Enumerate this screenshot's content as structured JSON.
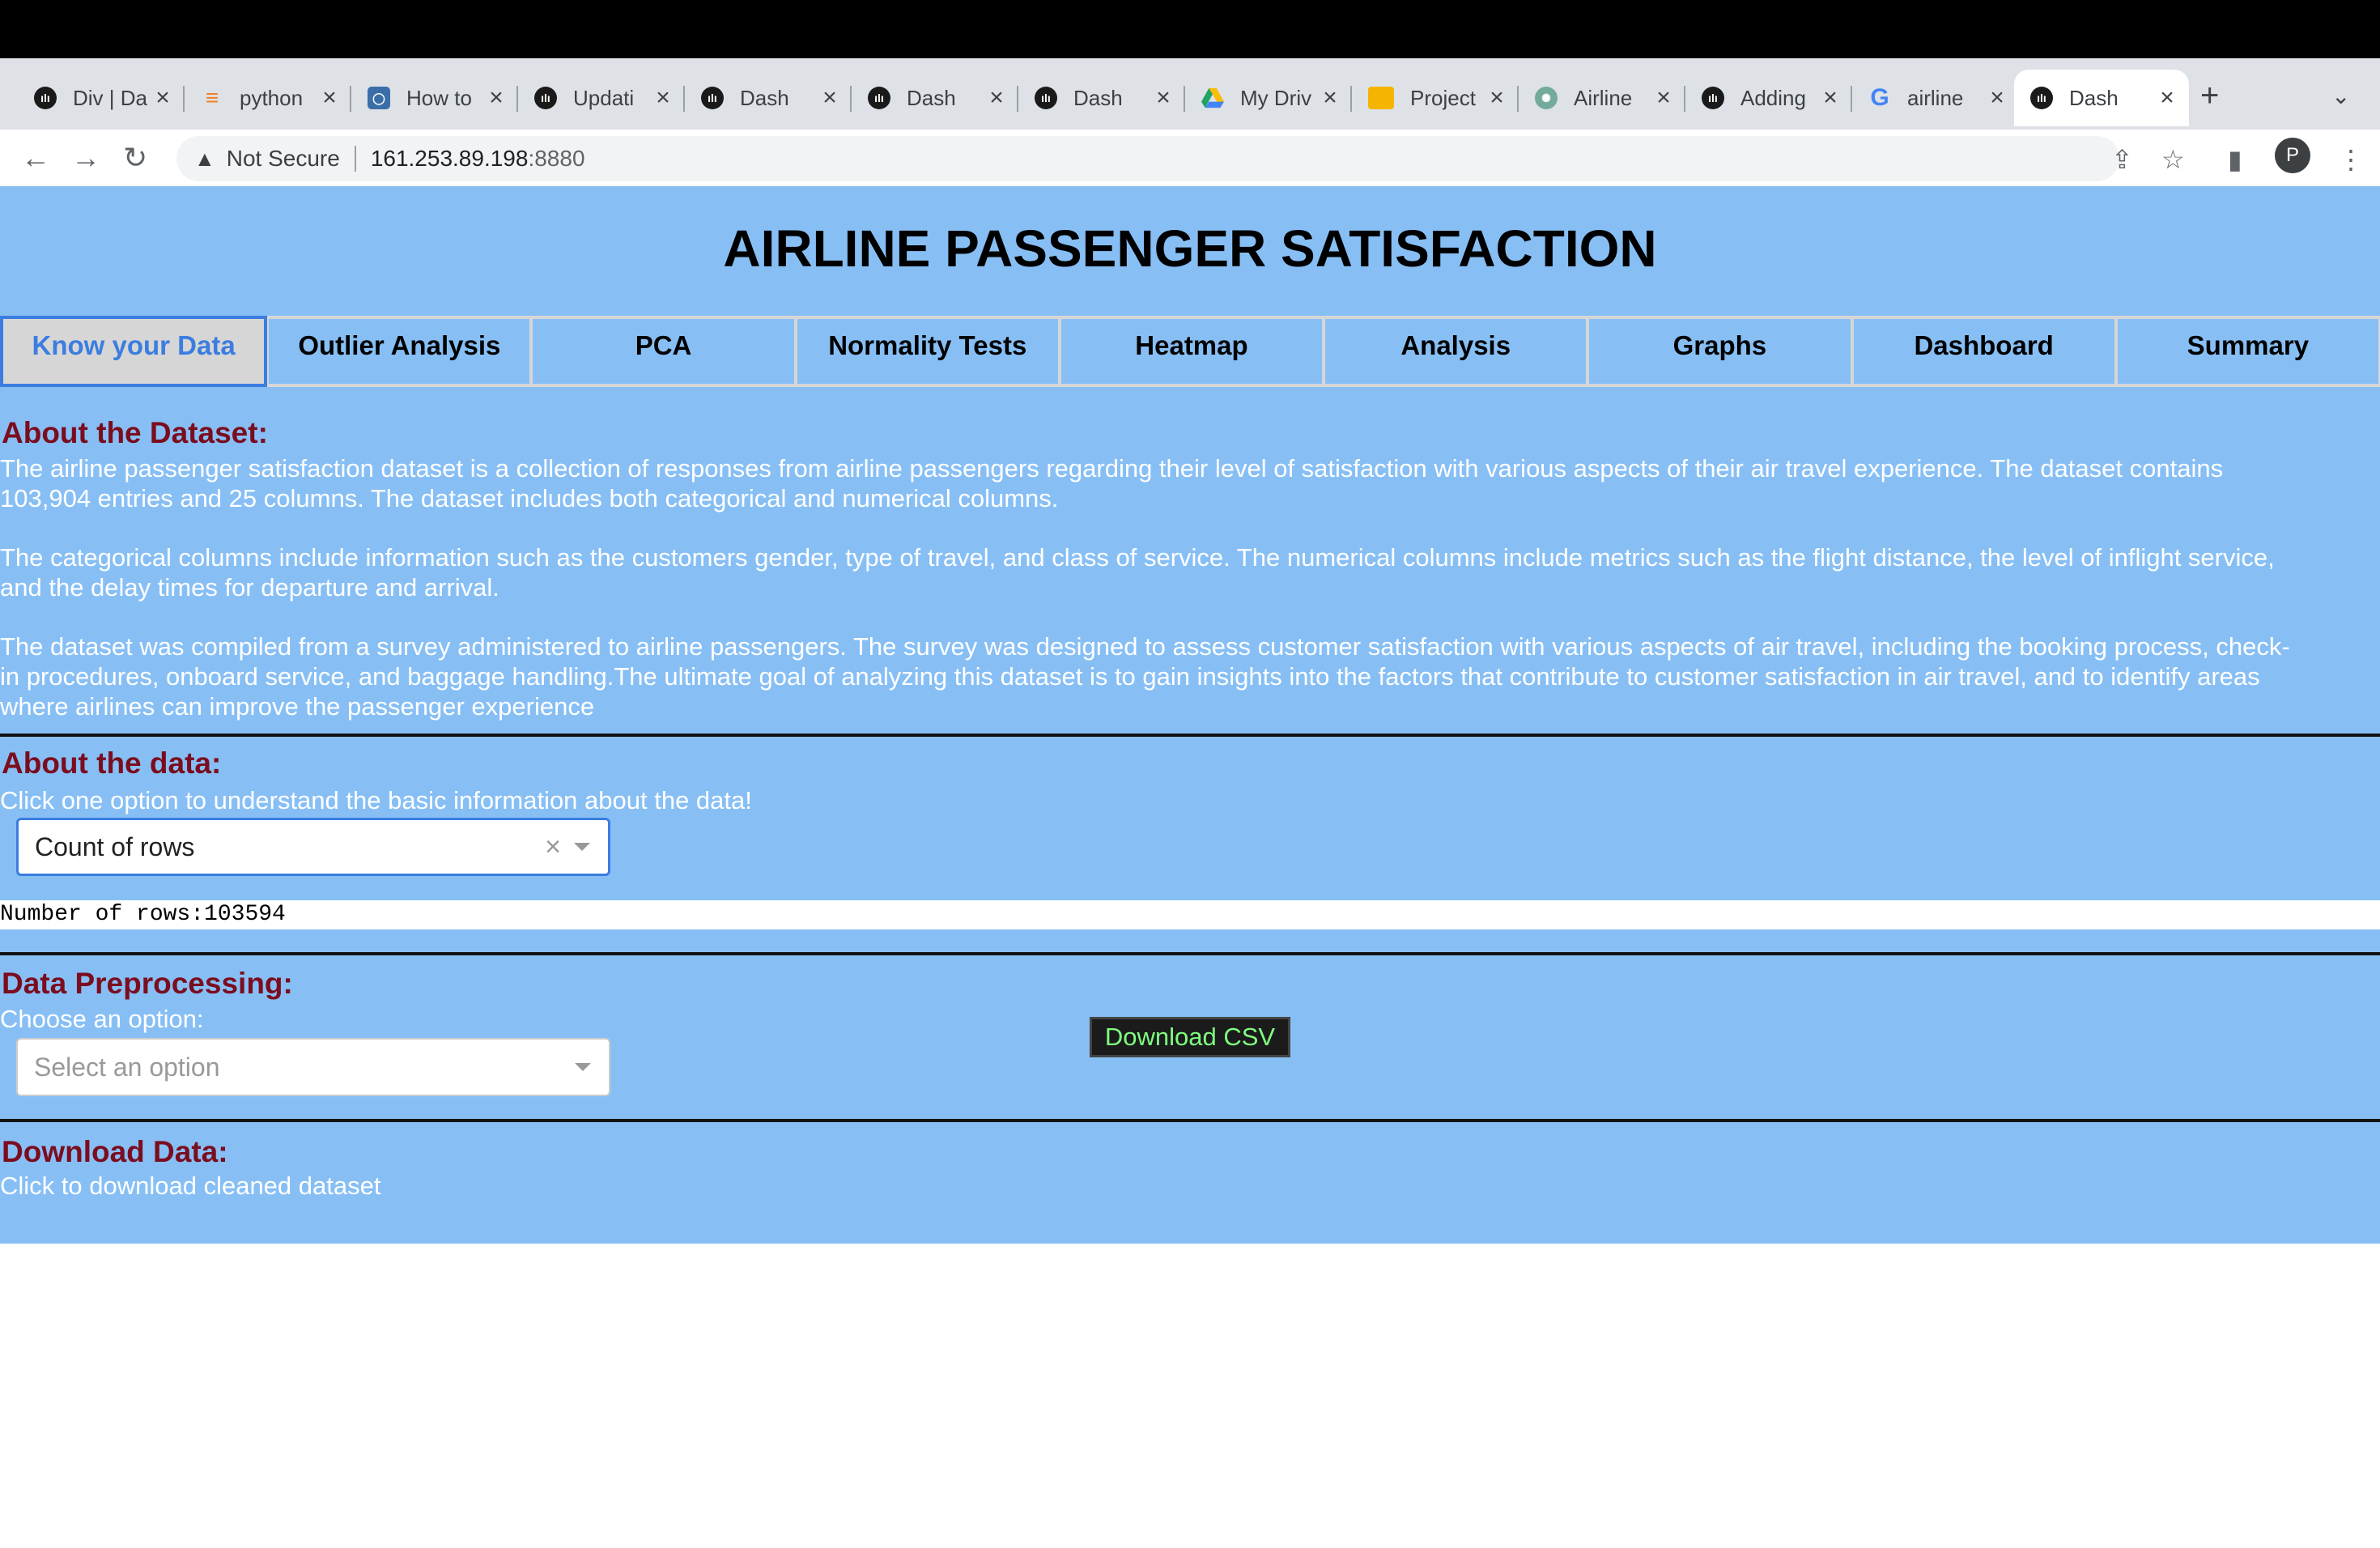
{
  "browser": {
    "tabs": [
      {
        "title": "Div | Da",
        "icon": "dash-icon"
      },
      {
        "title": "python",
        "icon": "stackoverflow-icon"
      },
      {
        "title": "How to",
        "icon": "blog-icon"
      },
      {
        "title": "Updati",
        "icon": "dash-icon"
      },
      {
        "title": "Dash",
        "icon": "dash-icon"
      },
      {
        "title": "Dash",
        "icon": "dash-icon"
      },
      {
        "title": "Dash",
        "icon": "dash-icon"
      },
      {
        "title": "My Driv",
        "icon": "google-drive-icon"
      },
      {
        "title": "Project",
        "icon": "google-slides-icon"
      },
      {
        "title": "Airline",
        "icon": "chatgpt-icon"
      },
      {
        "title": "Adding",
        "icon": "dash-icon"
      },
      {
        "title": "airline",
        "icon": "google-icon"
      },
      {
        "title": "Dash",
        "icon": "dash-icon",
        "active": true
      }
    ],
    "address": {
      "security_label": "Not Secure",
      "host": "161.253.89.198",
      "port": ":8880"
    },
    "profile_initial": "P"
  },
  "app": {
    "title": "AIRLINE PASSENGER SATISFACTION",
    "tabs": [
      "Know your Data",
      "Outlier Analysis",
      "PCA",
      "Normality Tests",
      "Heatmap",
      "Analysis",
      "Graphs",
      "Dashboard",
      "Summary"
    ],
    "selected_tab": "Know your Data"
  },
  "about_dataset": {
    "heading": "About the Dataset:",
    "p1_line1": "The airline passenger satisfaction dataset is a collection of responses from airline passengers regarding their level of satisfaction with various aspects of their air travel experience. The dataset contains",
    "p1_line2": "103,904 entries and 25 columns. The dataset includes both categorical and numerical columns.",
    "p2_line1": "The categorical columns include information such as the customers gender, type of travel, and class of service. The numerical columns include metrics such as the flight distance, the level of inflight service,",
    "p2_line2": "and the delay times for departure and arrival.",
    "p3_line1": "The dataset was compiled from a survey administered to airline passengers. The survey was designed to assess customer satisfaction with various aspects of air travel, including the booking process, check-",
    "p3_line2": "in procedures, onboard service, and baggage handling.The ultimate goal of analyzing this dataset is to gain insights into the factors that contribute to customer satisfaction in air travel, and to identify areas",
    "p3_line3": "where airlines can improve the passenger experience"
  },
  "about_data": {
    "heading": "About the data:",
    "instruction": "Click one option to understand the basic information about the data!",
    "dropdown_value": "Count of rows",
    "output": "Number of rows:103594"
  },
  "preprocessing": {
    "heading": "Data Preprocessing:",
    "instruction": "Choose an option:",
    "dropdown_placeholder": "Select an option"
  },
  "download": {
    "heading": "Download Data:",
    "instruction": "Click to download cleaned dataset",
    "button_label": "Download CSV"
  }
}
